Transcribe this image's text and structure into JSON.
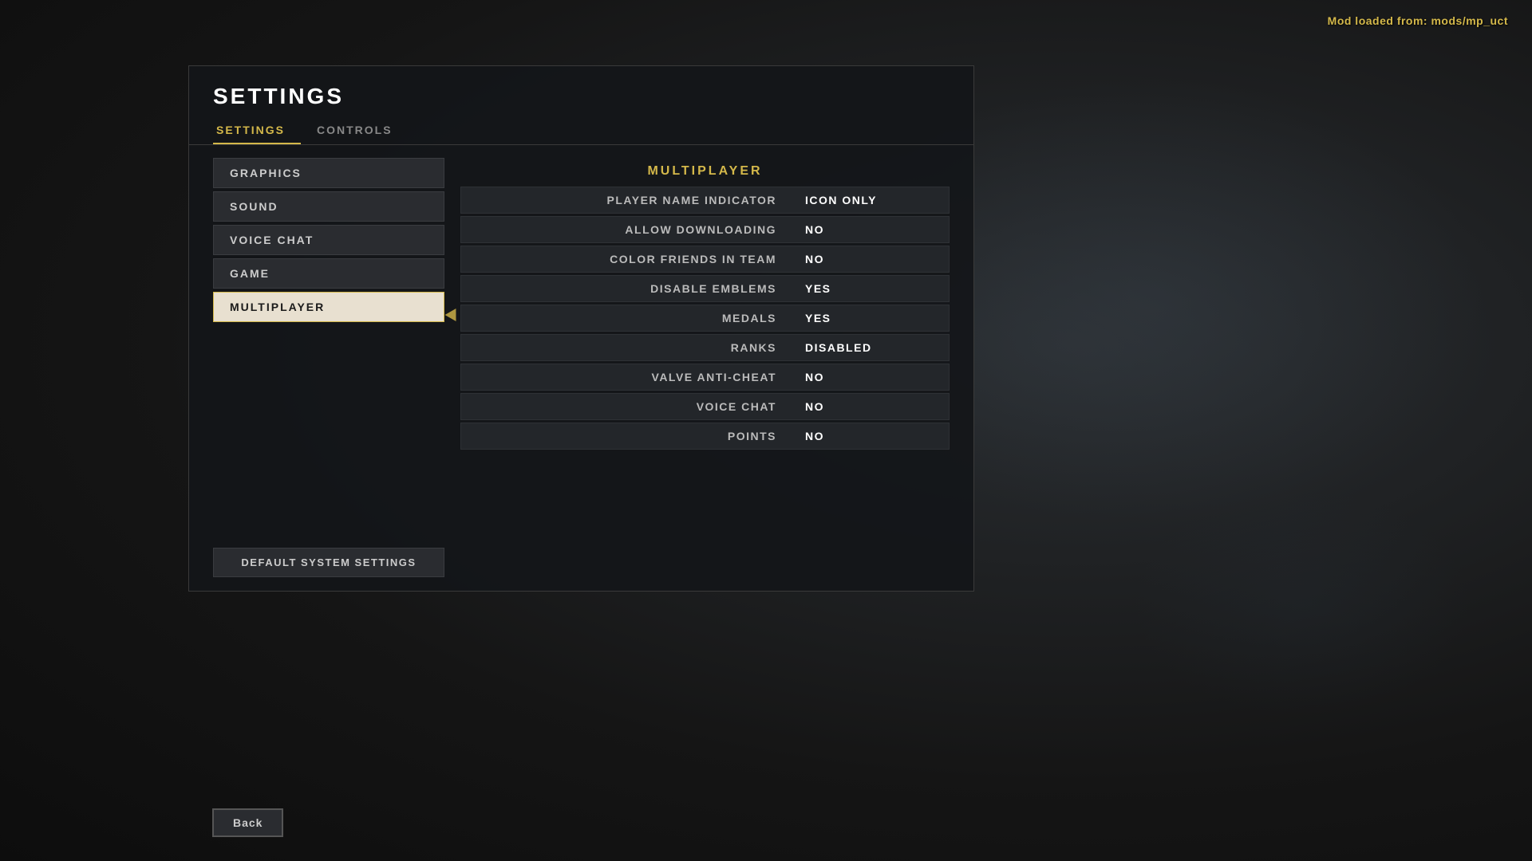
{
  "mod_info": "Mod loaded from: mods/mp_uct",
  "dialog": {
    "title": "SETTINGS",
    "tabs": [
      {
        "id": "settings",
        "label": "SETTINGS",
        "active": true
      },
      {
        "id": "controls",
        "label": "CONTROLS",
        "active": false
      }
    ]
  },
  "sidebar": {
    "items": [
      {
        "id": "graphics",
        "label": "GRAPHICS",
        "selected": false
      },
      {
        "id": "sound",
        "label": "SOUND",
        "selected": false
      },
      {
        "id": "voice-chat",
        "label": "VOICE CHAT",
        "selected": false
      },
      {
        "id": "game",
        "label": "GAME",
        "selected": false
      },
      {
        "id": "multiplayer",
        "label": "MULTIPLAYER",
        "selected": true
      }
    ],
    "default_btn": "DEFAULT SYSTEM SETTINGS"
  },
  "right_panel": {
    "section_title": "MULTIPLAYER",
    "settings": [
      {
        "label": "PLAYER NAME INDICATOR",
        "value": "ICON ONLY"
      },
      {
        "label": "ALLOW DOWNLOADING",
        "value": "NO"
      },
      {
        "label": "COLOR FRIENDS IN TEAM",
        "value": "NO"
      },
      {
        "label": "DISABLE EMBLEMS",
        "value": "YES"
      },
      {
        "label": "MEDALS",
        "value": "YES"
      },
      {
        "label": "RANKS",
        "value": "DISABLED"
      },
      {
        "label": "VALVE ANTI-CHEAT",
        "value": "NO"
      },
      {
        "label": "VOICE CHAT",
        "value": "NO"
      },
      {
        "label": "POINTS",
        "value": "NO"
      }
    ]
  },
  "back_button": "Back"
}
